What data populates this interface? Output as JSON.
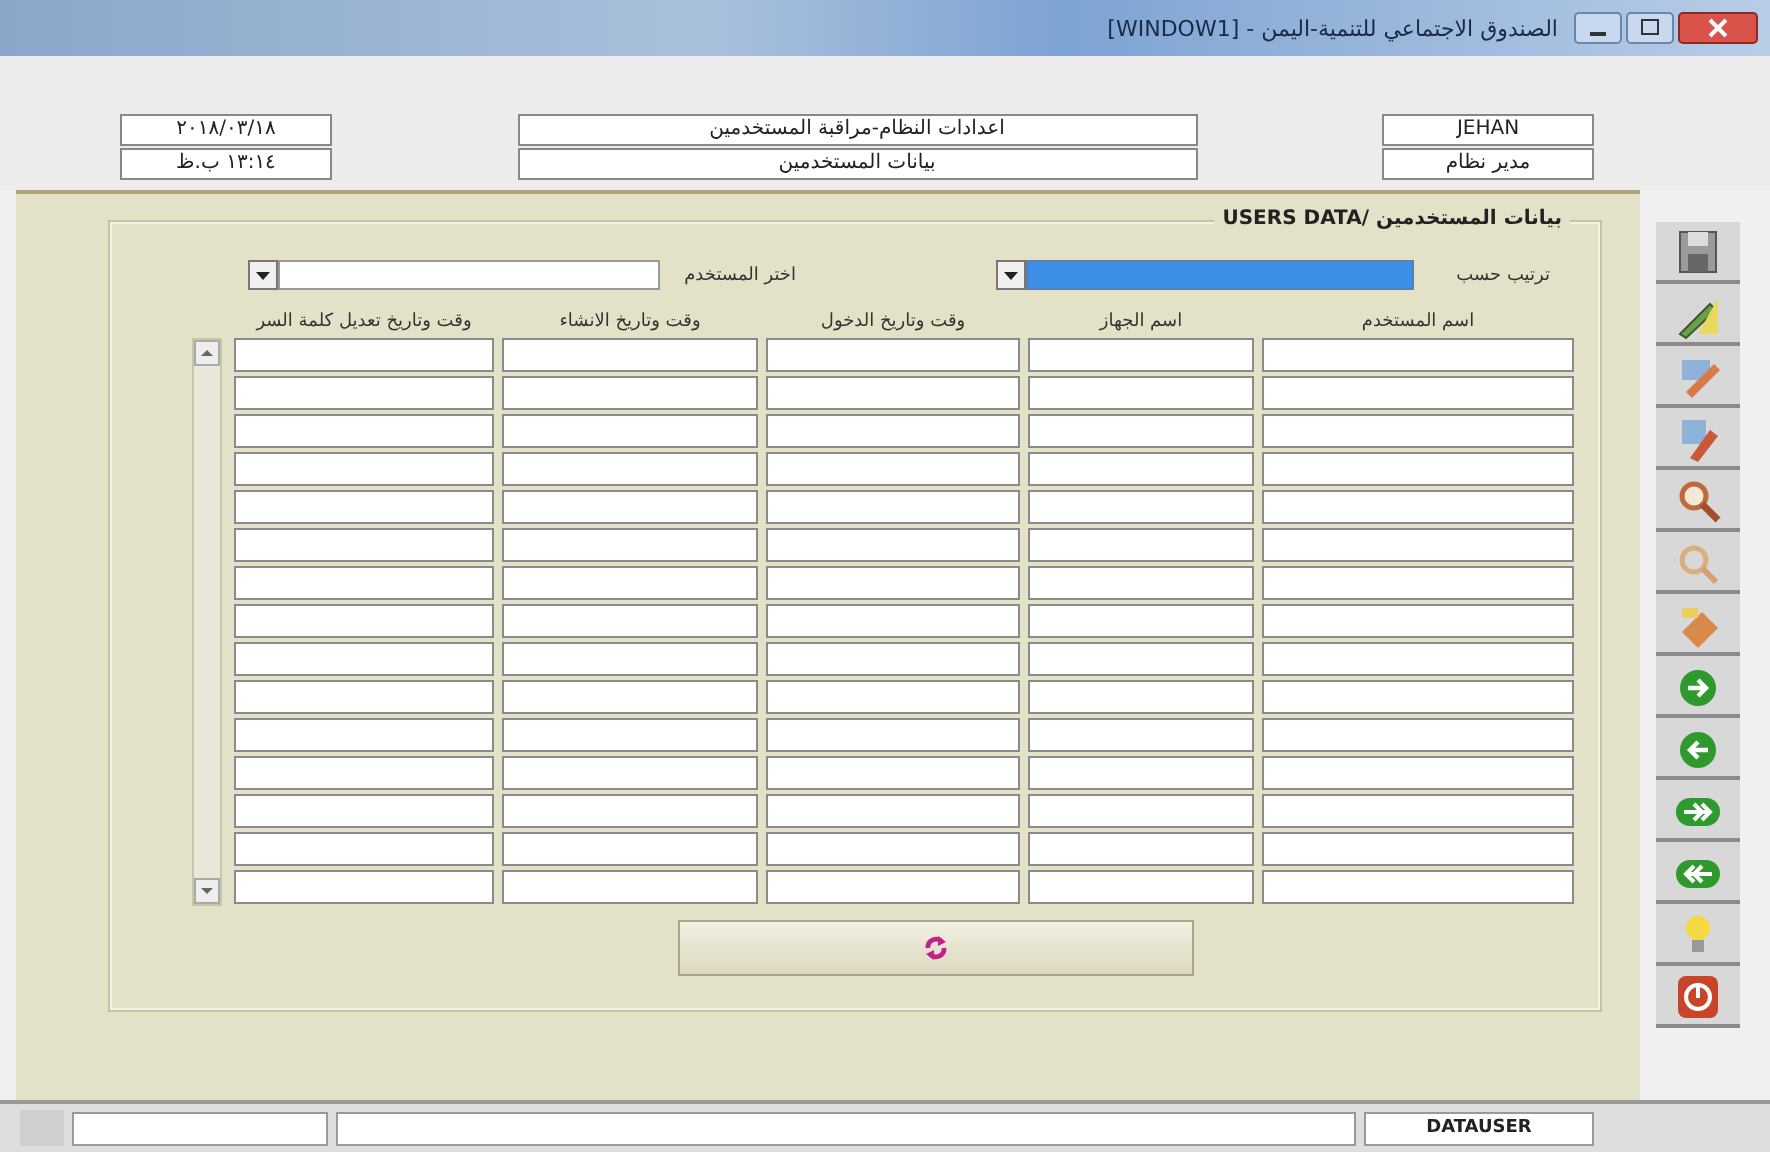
{
  "window": {
    "title": "الصندوق الاجتماعي للتنمية-اليمن - [WINDOW1]"
  },
  "header": {
    "date": "٢٠١٨/٠٣/١٨",
    "time": "١٣:١٤ ب.ظ",
    "screen_path": "اعدادات النظام-مراقبة المستخدمين",
    "screen_name": "بيانات المستخدمين",
    "user": "JEHAN",
    "role": "مدير نظام"
  },
  "panel": {
    "title": "بيانات المستخدمين /USERS DATA",
    "filters": [
      {
        "label": "ترتيب حسب",
        "selected": true
      },
      {
        "label": "اختر المستخدم",
        "selected": false
      }
    ],
    "columns": [
      "اسم المستخدم",
      "اسم الجهاز",
      "وقت وتاريخ الدخول",
      "وقت وتاريخ الانشاء",
      "وقت وتاريخ تعديل كلمة السر"
    ]
  },
  "status_bar": {
    "form_name": "DATAUSER"
  }
}
